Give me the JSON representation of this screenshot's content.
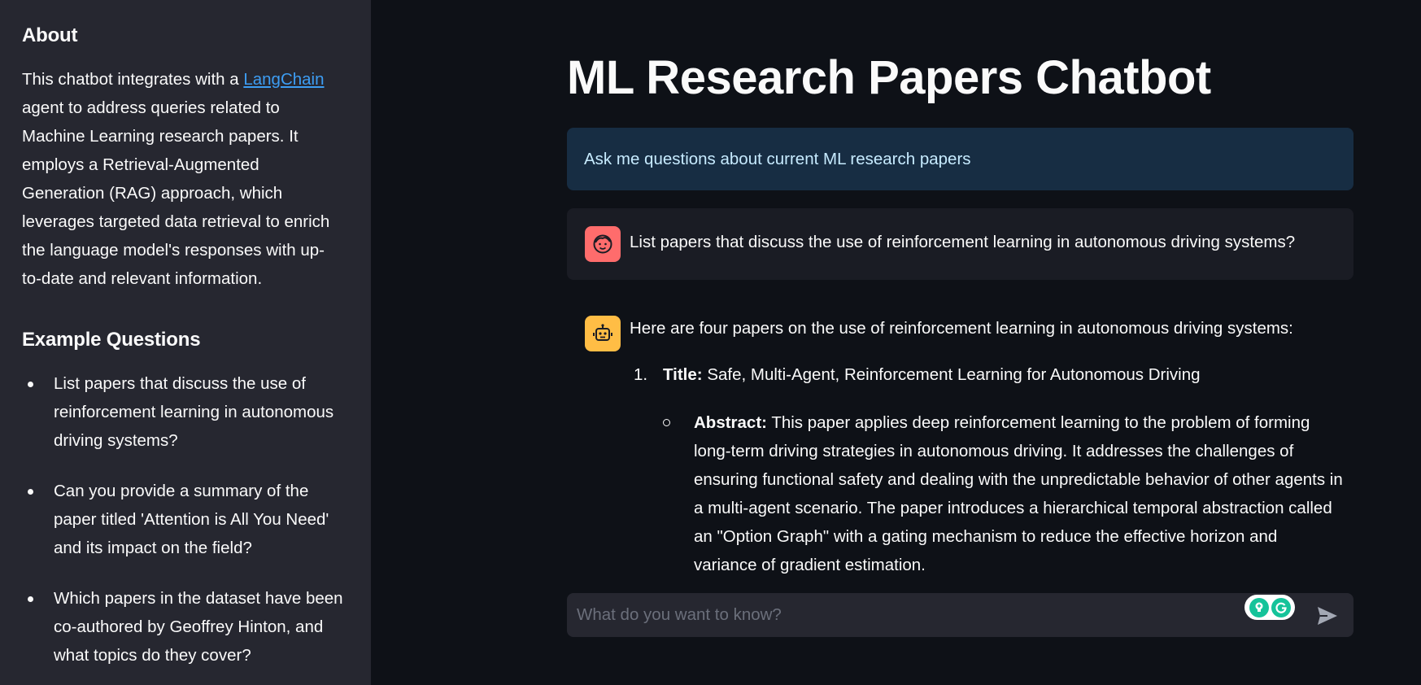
{
  "sidebar": {
    "about_heading": "About",
    "about_text_before": "This chatbot integrates with a ",
    "about_link": "LangChain",
    "about_text_after": " agent to address queries related to Machine Learning research papers. It employs a Retrieval-Augmented Generation (RAG) approach, which leverages targeted data retrieval to enrich the language model's responses with up-to-date and relevant information.",
    "examples_heading": "Example Questions",
    "examples": [
      "List papers that discuss the use of reinforcement learning in autonomous driving systems?",
      "Can you provide a summary of the paper titled 'Attention is All You Need' and its impact on the field?",
      "Which papers in the dataset have been co-authored by Geoffrey Hinton, and what topics do they cover?"
    ]
  },
  "main": {
    "title": "ML Research Papers Chatbot",
    "info": "Ask me questions about current ML research papers",
    "user_message": "List papers that discuss the use of reinforcement learning in autonomous driving systems?",
    "assistant": {
      "intro": "Here are four papers on the use of reinforcement learning in autonomous driving systems:",
      "items": [
        {
          "number": "1.",
          "title_label": "Title:",
          "title": "Safe, Multi-Agent, Reinforcement Learning for Autonomous Driving",
          "abstract_label": "Abstract:",
          "abstract": "This paper applies deep reinforcement learning to the problem of forming long-term driving strategies in autonomous driving. It addresses the challenges of ensuring functional safety and dealing with the unpredictable behavior of other agents in a multi-agent scenario. The paper introduces a hierarchical temporal abstraction called an \"Option Graph\" with a gating mechanism to reduce the effective horizon and variance of gradient estimation."
        }
      ]
    }
  },
  "chat_input": {
    "placeholder": "What do you want to know?"
  },
  "icons": {
    "user_avatar": "face-icon",
    "assistant_avatar": "robot-icon",
    "send": "send-arrow-icon",
    "grammarly": "grammarly-icon"
  },
  "colors": {
    "background": "#0e1117",
    "sidebar": "#262730",
    "info_bg": "#172d43",
    "info_text": "#c7ebff",
    "user_avatar": "#ff6c6c",
    "assistant_avatar": "#ffbd45",
    "link": "#3d9df3"
  }
}
